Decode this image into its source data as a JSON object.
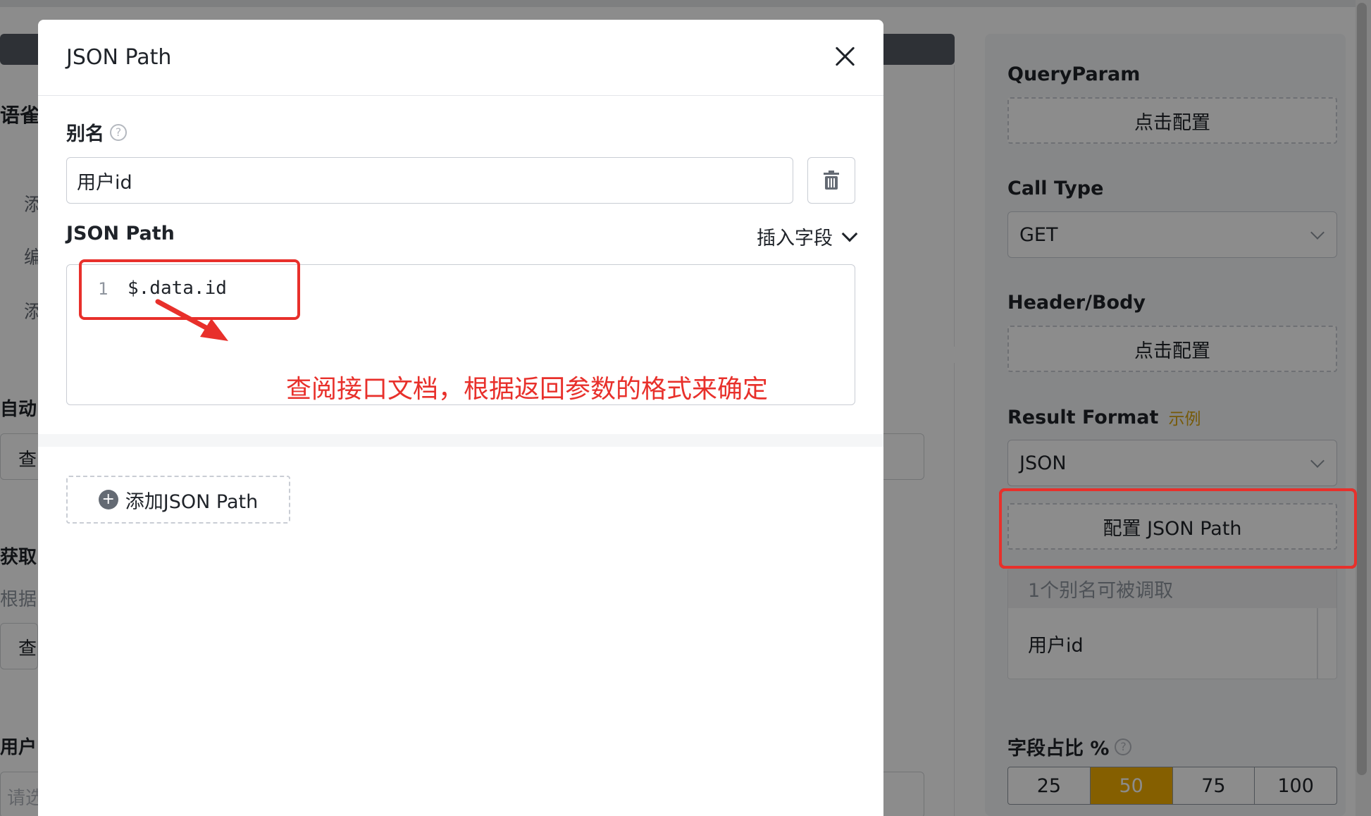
{
  "modal": {
    "title": "JSON Path",
    "alias_label": "别名",
    "alias_help": "?",
    "alias_value": "用户id",
    "json_path_label": "JSON Path",
    "insert_field_label": "插入字段",
    "code": {
      "line_number": "1",
      "text": "$.data.id"
    },
    "annotation": "查阅接口文档，根据返回参数的格式来确定",
    "add_button_label": "添加JSON Path"
  },
  "right_panel": {
    "query_param_label": "QueryParam",
    "query_param_button": "点击配置",
    "call_type_label": "Call Type",
    "call_type_value": "GET",
    "header_body_label": "Header/Body",
    "header_body_button": "点击配置",
    "result_format_label": "Result Format",
    "result_format_example": "示例",
    "result_format_value": "JSON",
    "configure_json_path_button": "配置 JSON Path",
    "alias_count_text": "1个别名可被调取",
    "alias_items": [
      "用户id"
    ],
    "field_ratio_label": "字段占比 %",
    "field_ratio_help": "?",
    "field_ratio_options": [
      "25",
      "50",
      "75",
      "100"
    ],
    "field_ratio_selected": "50"
  },
  "background": {
    "left_fragments": [
      "语雀",
      "添",
      "编",
      "添",
      "自动",
      "查",
      "获取",
      "根据",
      "查",
      "用户",
      "请选"
    ]
  },
  "colors": {
    "accent": "#f2ad00",
    "annotation_red": "#e8302b",
    "example_link": "#d8a411"
  }
}
